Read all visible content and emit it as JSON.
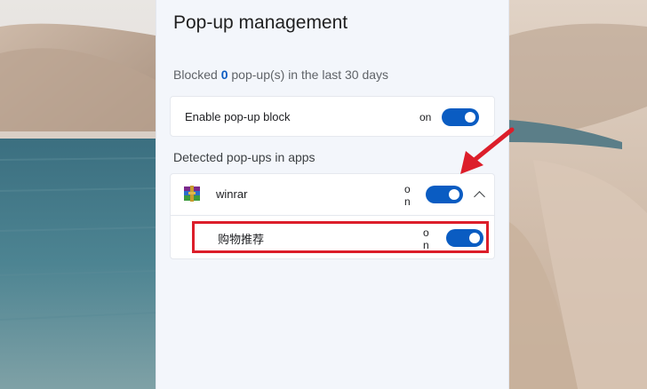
{
  "popup_panel": {
    "title": "Pop-up management",
    "blocked_prefix": "Blocked ",
    "blocked_count": "0",
    "blocked_suffix": " pop-up(s) in the last 30 days",
    "enable_block": {
      "label": "Enable pop-up block",
      "state_text": "on",
      "enabled": true
    },
    "detected_section_label": "Detected pop-ups in apps",
    "apps": [
      {
        "name": "winrar",
        "icon": "winrar-icon",
        "state_text": "on",
        "enabled": true,
        "expanded": true,
        "expand_icon": "chevron-up-icon",
        "children": [
          {
            "label": "购物推荐",
            "state_text": "on",
            "enabled": true
          }
        ]
      }
    ]
  },
  "annotations": {
    "arrow_color": "#dc1e2a",
    "highlight_color": "#dc1e2a"
  },
  "colors": {
    "accent": "#0a5cc2",
    "panel_bg": "#f3f6fb",
    "card_bg": "#ffffff"
  }
}
